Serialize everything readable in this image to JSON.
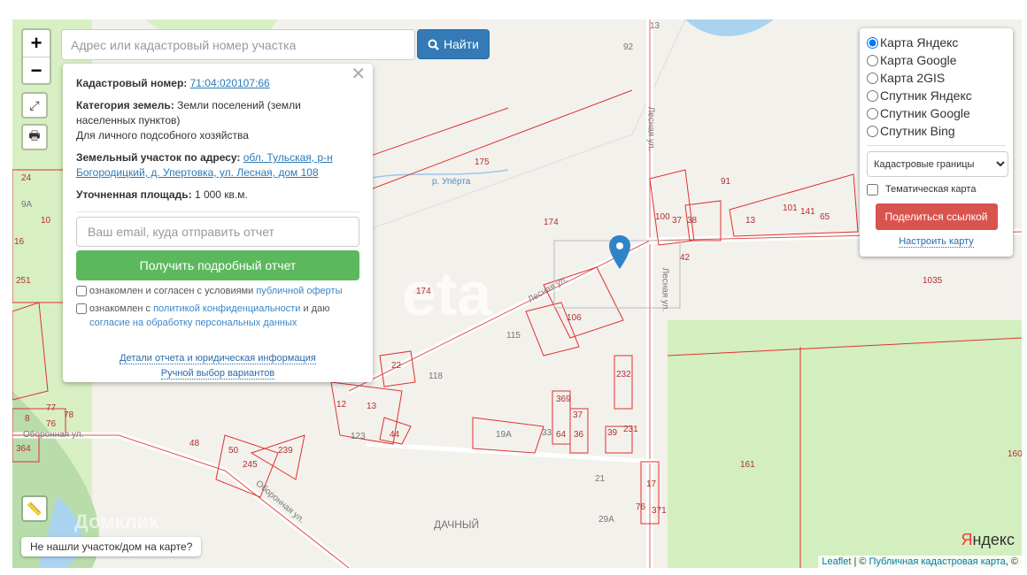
{
  "search": {
    "placeholder": "Адрес или кадастровый номер участка",
    "button": "Найти"
  },
  "controls": {
    "zoom_in": "+",
    "zoom_out": "−"
  },
  "popup": {
    "cad_label": "Кадастровый номер:",
    "cad_value": "71:04:020107:66",
    "cat_label": "Категория земель:",
    "cat_value": "Земли поселений (земли населенных пунктов)",
    "use": "Для личного подсобного хозяйства",
    "addr_label": "Земельный участок по адресу:",
    "addr_value": "обл. Тульская, р-н Богородицкий, д. Упертовка, ул. Лесная, дом 108",
    "area_label": "Уточненная площадь:",
    "area_value": "1 000 кв.м.",
    "email_placeholder": "Ваш email, куда отправить отчет",
    "get_button": "Получить подробный отчет",
    "chk1_text": "ознакомлен и согласен с условиями ",
    "chk1_link": "публичной оферты",
    "chk2_text": "ознакомлен с ",
    "chk2_link": "политикой конфиденциальности",
    "chk2_mid": " и даю ",
    "chk2_link2": "согласие на обработку персональных данных",
    "details_link": "Детали отчета и юридическая информация",
    "manual_link": "Ручной выбор вариантов"
  },
  "layers": {
    "options": [
      "Карта Яндекс",
      "Карта Google",
      "Карта 2GIS",
      "Спутник Яндекс",
      "Спутник Google",
      "Спутник Bing"
    ],
    "selected": "Кадастровые границы",
    "thematic": "Тематическая карта",
    "share": "Поделиться ссылкой",
    "configure": "Настроить карту"
  },
  "notfound": "Не нашли участок/дом на карте?",
  "attribution": {
    "leaflet": "Leaflet",
    "sep": " | © ",
    "pkk": "Публичная кадастровая карта",
    "tail": ", ©"
  },
  "yandex_logo": "Яндекс",
  "map_labels": [
    "13",
    "92",
    "175",
    "174",
    "174",
    "91",
    "100",
    "37",
    "38",
    "13",
    "101",
    "141",
    "65",
    "42",
    "1035",
    "106",
    "115",
    "118",
    "22",
    "232",
    "369",
    "37",
    "64",
    "36",
    "39",
    "231",
    "19А",
    "33",
    "161",
    "160",
    "17",
    "76",
    "371",
    "29А",
    "21",
    "ДАЧНЫЙ",
    "12",
    "13",
    "44",
    "123",
    "48",
    "50",
    "245",
    "239",
    "8",
    "77",
    "76",
    "78",
    "364",
    "24",
    "9А",
    "10",
    "16",
    "251",
    "Лесная ул.",
    "Лесная ул.",
    "Лесная ул.",
    "Оборонная ул.",
    "Оборонная ул.",
    "р. Упёрта"
  ]
}
